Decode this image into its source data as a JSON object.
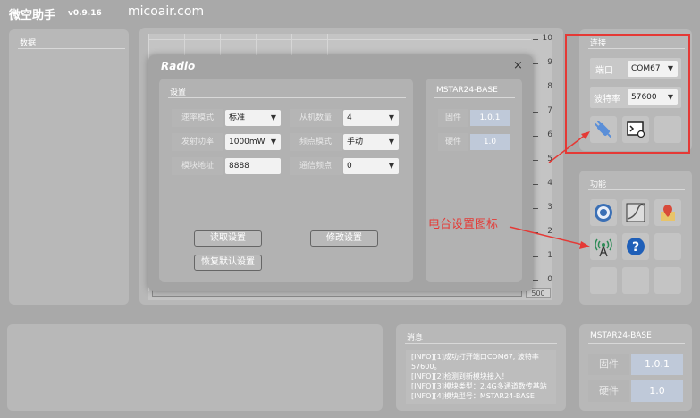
{
  "header": {
    "app_title": "微空助手",
    "version": "v0.9.16",
    "site": "micoair.com"
  },
  "data_panel": {
    "title": "数据"
  },
  "chart_data": {
    "type": "line",
    "series": [],
    "y_ticks": [
      "10",
      "9",
      "8",
      "7",
      "6",
      "5",
      "4",
      "3",
      "2",
      "1",
      "0"
    ],
    "ylim": [
      0,
      10
    ],
    "x_max_label": "500"
  },
  "dialog": {
    "title": "Radio",
    "close": "×",
    "settings_title": "设置",
    "fields": [
      {
        "label": "速率模式",
        "value": "标准"
      },
      {
        "label": "发射功率",
        "value": "1000mW"
      },
      {
        "label": "模块地址",
        "value": "8888"
      },
      {
        "label": "从机数量",
        "value": "4"
      },
      {
        "label": "频点模式",
        "value": "手动"
      },
      {
        "label": "通信频点",
        "value": "0"
      }
    ],
    "read_btn": "读取设置",
    "modify_btn": "修改设置",
    "reset_btn": "恢复默认设置",
    "module_title": "MSTAR24-BASE",
    "firmware_label": "固件",
    "firmware_value": "1.0.1",
    "hardware_label": "硬件",
    "hardware_value": "1.0"
  },
  "connect": {
    "title": "连接",
    "port_label": "端口",
    "port_value": "COM67",
    "baud_label": "波特率",
    "baud_value": "57600"
  },
  "functions": {
    "title": "功能"
  },
  "annotation": {
    "text": "电台设置图标",
    "color": "#e53935"
  },
  "messages": {
    "title": "消息",
    "lines": [
      "[INFO][1]成功打开端口COM67, 波特率",
      "57600。",
      "[INFO][2]检测到新模块接入！",
      "[INFO][3]模块类型：2.4G多通道数传基站",
      "[INFO][4]模块型号：MSTAR24-BASE"
    ]
  },
  "module_panel": {
    "title": "MSTAR24-BASE",
    "firmware_label": "固件",
    "firmware_value": "1.0.1",
    "hardware_label": "硬件",
    "hardware_value": "1.0"
  }
}
